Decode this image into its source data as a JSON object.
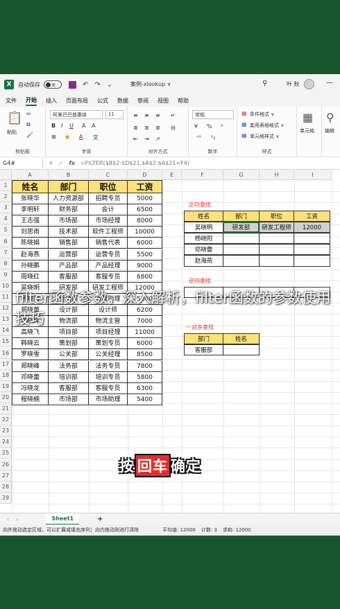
{
  "titlebar": {
    "autosave": "自动保存",
    "autosave_state": "关",
    "doc_title": "案例-xlookup ∨",
    "user": "叶 秋"
  },
  "menu": [
    "文件",
    "开始",
    "插入",
    "页面布局",
    "公式",
    "数据",
    "审阅",
    "视图",
    "帮助"
  ],
  "ribbon": {
    "paste": "粘贴",
    "clipboard": "剪贴板",
    "font_name": "阿里巴巴普惠体",
    "font_size": "11",
    "font": "字体",
    "align": "对齐方式",
    "number_format": "常规",
    "number": "数字",
    "cond_format": "条件格式 ∨",
    "table_format": "套用表格格式 ∨",
    "cell_style": "单元格样式 ∨",
    "styles": "样式",
    "cells": "单元格",
    "edit": "编辑"
  },
  "formula": {
    "namebox": "G4#",
    "text": "=FILTER($B$2:$D$21,$A$2:$A$21=F4)"
  },
  "columns": [
    "A",
    "B",
    "C",
    "D",
    "E",
    "F",
    "G",
    "H",
    "I"
  ],
  "rows": [
    "1",
    "2",
    "3",
    "4",
    "5",
    "6",
    "7",
    "8",
    "9",
    "10",
    "11",
    "12",
    "13",
    "14",
    "15",
    "16",
    "17",
    "18",
    "19",
    "20",
    "21",
    "22",
    "23",
    "24",
    "25",
    "26",
    "27",
    "28",
    "29"
  ],
  "main_table": {
    "headers": [
      "姓名",
      "部门",
      "职位",
      "工资"
    ],
    "rows": [
      [
        "张晓华",
        "人力资源部",
        "招聘专员",
        "5000"
      ],
      [
        "李明轩",
        "财务部",
        "会计",
        "6500"
      ],
      [
        "王志强",
        "市场部",
        "市场经理",
        "8000"
      ],
      [
        "刘思雨",
        "技术部",
        "软件工程师",
        "10000"
      ],
      [
        "陈晓娟",
        "销售部",
        "销售代表",
        "6000"
      ],
      [
        "赵海燕",
        "运营部",
        "运营专员",
        "5500"
      ],
      [
        "孙晓鹏",
        "产品部",
        "产品经理",
        "9000"
      ],
      [
        "周晓红",
        "客服部",
        "客服专员",
        "6800"
      ],
      [
        "吴晓明",
        "研发部",
        "研发工程师",
        "12000"
      ],
      [
        "杨晓阳",
        "行政部",
        "行政助理",
        "5200"
      ],
      [
        "郑晓蕾",
        "设计部",
        "设计师",
        "6200"
      ],
      [
        "郭晓辉",
        "物流部",
        "物流主管",
        "7000"
      ],
      [
        "高晓飞",
        "项目部",
        "项目经理",
        "11000"
      ],
      [
        "韩晓云",
        "策划部",
        "策划专员",
        "6000"
      ],
      [
        "罗晓雪",
        "公关部",
        "公关经理",
        "8500"
      ],
      [
        "郑晓峰",
        "法务部",
        "法务专员",
        "7800"
      ],
      [
        "邓晓蕾",
        "培训部",
        "培训专员",
        "5800"
      ],
      [
        "冯晓龙",
        "客服部",
        "客服专员",
        "6300"
      ],
      [
        "程晓楠",
        "市场部",
        "市场助理",
        "5400"
      ]
    ]
  },
  "forward_lookup": {
    "title": "正向查找",
    "headers": [
      "姓名",
      "部门",
      "职位",
      "工资"
    ],
    "rows": [
      [
        "吴晓明",
        "研发部",
        "研发工程师",
        "12000"
      ],
      [
        "杨晓阳",
        "",
        "",
        ""
      ],
      [
        "邓晓蕾",
        "",
        "",
        ""
      ],
      [
        "赵海燕",
        "",
        "",
        ""
      ]
    ]
  },
  "reverse_lookup": {
    "title": "逆向查找",
    "row": [
      "",
      "",
      "",
      ""
    ]
  },
  "one_to_many": {
    "title": "一对多查找",
    "headers": [
      "部门",
      "姓名"
    ],
    "rows": [
      [
        "客服部",
        ""
      ]
    ]
  },
  "sheet": {
    "tab": "Sheet1",
    "add": "+"
  },
  "status": {
    "left": "向外拖动选定区域，可以扩展或填充序列；向内拖动则进行清除",
    "avg": "平均值: 12000",
    "count": "计数: 3",
    "sum": "求和: 12000"
  },
  "overlay": {
    "text": "filter函数参数，深入解析，filter函数的参数使用技巧"
  },
  "caption": {
    "pre": "按",
    "hl": "回车",
    "post": "确定"
  }
}
